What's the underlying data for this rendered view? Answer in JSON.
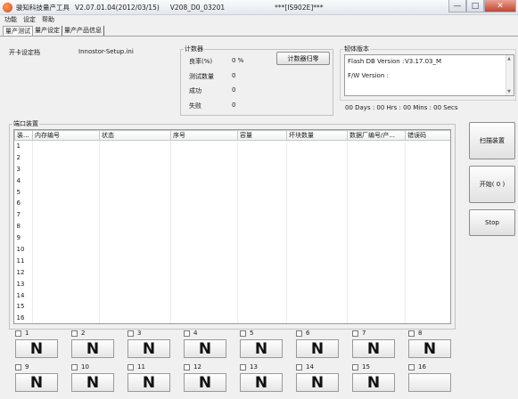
{
  "titlebar": {
    "app_name": "骏知科技量产工具",
    "version": "V2.07.01.04(2012/03/15)",
    "build": "V208_D0_03201",
    "device": "***[IS902E]***",
    "minimize": "—",
    "maximize": "□",
    "close": "✕"
  },
  "menu": {
    "items": [
      "功能",
      "设定",
      "帮助"
    ]
  },
  "tabs": [
    {
      "label": "量产测试",
      "active": true
    },
    {
      "label": "量产设定",
      "active": false
    },
    {
      "label": "量产产品信息",
      "active": false
    }
  ],
  "card_settings": {
    "label": "开卡设定档",
    "value": "Innostor-Setup.ini"
  },
  "counter": {
    "legend": "计数器",
    "rows": [
      {
        "label": "良率(%)",
        "value": "0 %"
      },
      {
        "label": "测试数量",
        "value": "0"
      },
      {
        "label": "成功",
        "value": "0"
      },
      {
        "label": "失败",
        "value": "0"
      }
    ],
    "reset_button": "计数器归零"
  },
  "firmware": {
    "legend": "韧体版本",
    "flash_db_label": "Flash DB Version :",
    "flash_db_value": "V3.17.03_M",
    "fw_label": "F/W Version :",
    "fw_value": "",
    "elapsed": "00 Days : 00 Hrs : 00 Mins : 00 Secs"
  },
  "ports_group": {
    "legend": "端口装置"
  },
  "table": {
    "columns": [
      "装...",
      "内存编号",
      "状态",
      "序号",
      "容量",
      "坏块数量",
      "数据厂编号/产...",
      "错误码"
    ],
    "rows": [
      "1",
      "2",
      "3",
      "4",
      "5",
      "6",
      "7",
      "8",
      "9",
      "10",
      "11",
      "12",
      "13",
      "14",
      "15",
      "16"
    ]
  },
  "actions": {
    "scan": "扫描装置",
    "start": "开始( 0 )",
    "stop": "Stop"
  },
  "ports": [
    {
      "num": "1",
      "state": "N"
    },
    {
      "num": "2",
      "state": "N"
    },
    {
      "num": "3",
      "state": "N"
    },
    {
      "num": "4",
      "state": "N"
    },
    {
      "num": "5",
      "state": "N"
    },
    {
      "num": "6",
      "state": "N"
    },
    {
      "num": "7",
      "state": "N"
    },
    {
      "num": "8",
      "state": "N"
    },
    {
      "num": "9",
      "state": "N"
    },
    {
      "num": "10",
      "state": "N"
    },
    {
      "num": "11",
      "state": "N"
    },
    {
      "num": "12",
      "state": "N"
    },
    {
      "num": "13",
      "state": "N"
    },
    {
      "num": "14",
      "state": "N"
    },
    {
      "num": "15",
      "state": "N"
    },
    {
      "num": "16",
      "state": ""
    }
  ]
}
